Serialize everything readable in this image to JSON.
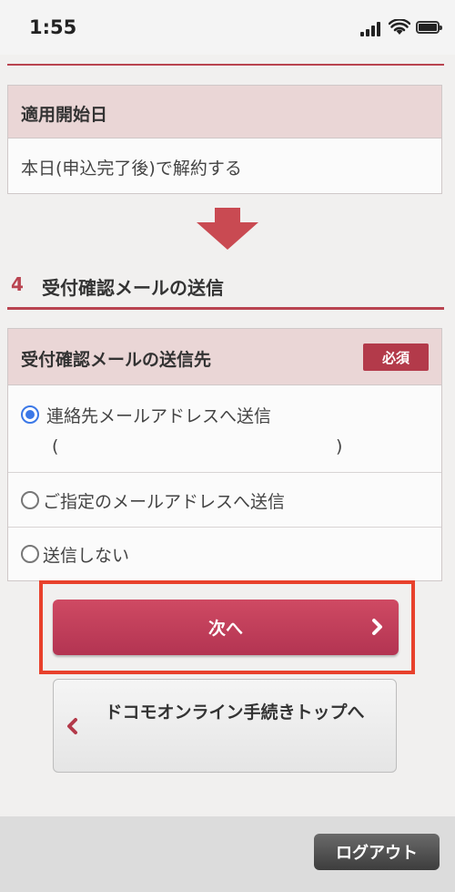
{
  "status_bar": {
    "time": "1:55"
  },
  "start_date": {
    "header": "適用開始日",
    "value": "本日(申込完了後)で解約する"
  },
  "section": {
    "number": "4",
    "title": "受付確認メールの送信"
  },
  "mail_dest": {
    "header": "受付確認メールの送信先",
    "required_badge": "必須",
    "options": [
      {
        "label": "連絡先メールアドレスへ送信",
        "sub_open": "(",
        "sub_close": ")",
        "selected": true
      },
      {
        "label": "ご指定のメールアドレスへ送信",
        "selected": false
      },
      {
        "label": "送信しない",
        "selected": false
      }
    ]
  },
  "buttons": {
    "next": "次へ",
    "top": "ドコモオンライン手続きトップへ",
    "logout": "ログアウト"
  },
  "colors": {
    "accent": "#b94450",
    "highlight_frame": "#e8412c",
    "radio_selected": "#3b78e7"
  }
}
